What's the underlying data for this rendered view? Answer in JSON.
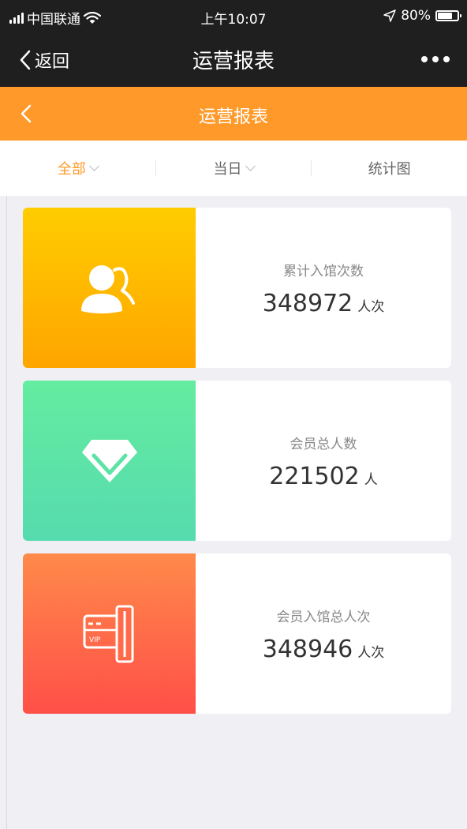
{
  "status_bar": {
    "carrier": "中国联通",
    "time": "上午10:07",
    "battery_percent": "80%",
    "battery_level": 0.8,
    "signal_icon": "signal-bars-icon",
    "wifi_icon": "wifi-icon",
    "location_icon": "location-arrow-icon"
  },
  "wechat_nav": {
    "back_label": "返回",
    "title": "运营报表",
    "more_icon": "more-dots-icon"
  },
  "app_header": {
    "title": "运营报表",
    "back_icon": "chevron-left-icon",
    "color": "#ff9a2a"
  },
  "filters": [
    {
      "label": "全部",
      "dropdown": true,
      "active": true
    },
    {
      "label": "当日",
      "dropdown": true,
      "active": false
    },
    {
      "label": "统计图",
      "dropdown": false,
      "active": false
    }
  ],
  "cards": [
    {
      "label": "累计入馆次数",
      "value": "348972",
      "unit": "人次",
      "icon": "users-icon",
      "colors": [
        "#ffcd00",
        "#ffa500"
      ]
    },
    {
      "label": "会员总人数",
      "value": "221502",
      "unit": "人",
      "icon": "diamond-icon",
      "colors": [
        "#64eca0",
        "#56dbae"
      ]
    },
    {
      "label": "会员入馆总人次",
      "value": "348946",
      "unit": "人次",
      "icon": "vip-card-icon",
      "colors": [
        "#ff8a4a",
        "#ff4f48"
      ]
    }
  ]
}
